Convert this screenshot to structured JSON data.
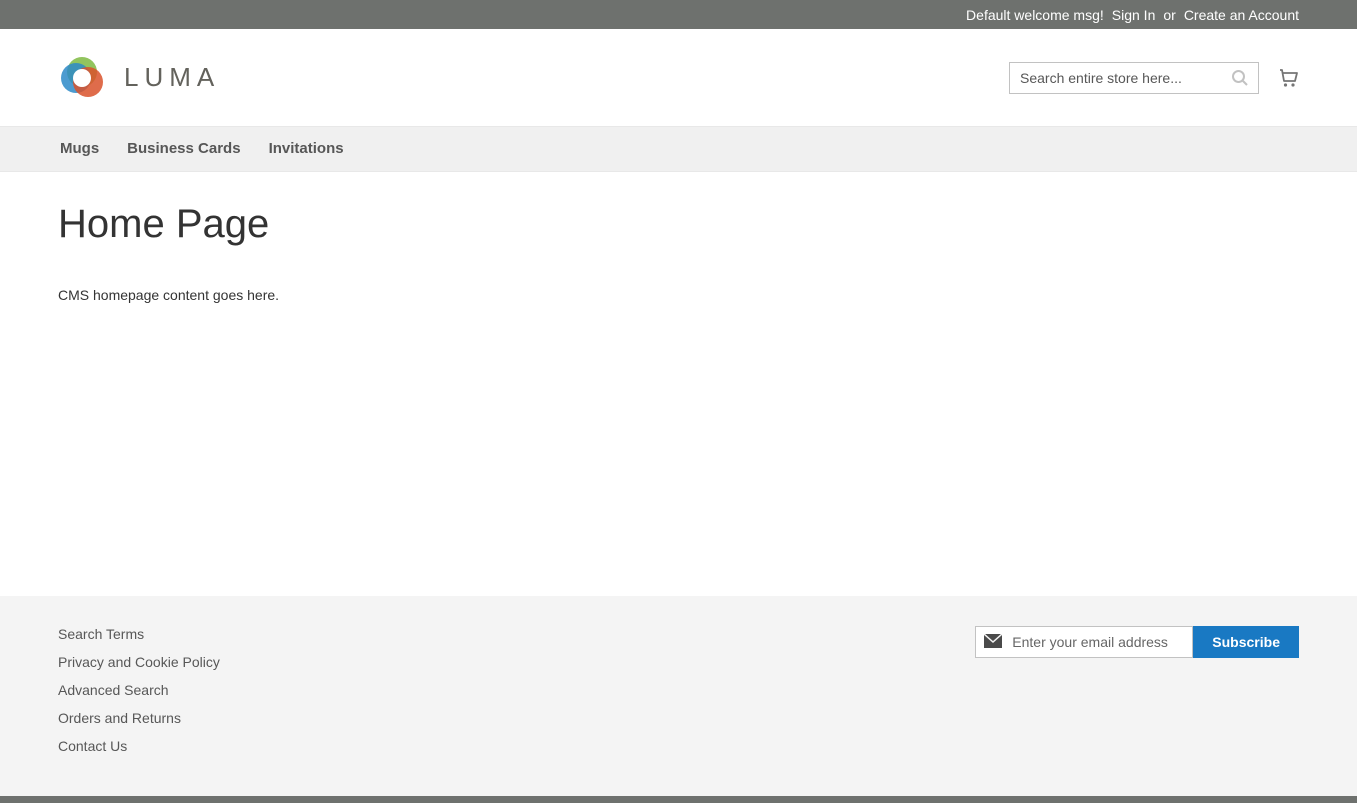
{
  "panel": {
    "welcome": "Default welcome msg!",
    "sign_in": "Sign In",
    "or": "or",
    "create_account": "Create an Account"
  },
  "logo": {
    "text": "LUMA"
  },
  "search": {
    "placeholder": "Search entire store here..."
  },
  "nav": {
    "items": [
      {
        "label": "Mugs"
      },
      {
        "label": "Business Cards"
      },
      {
        "label": "Invitations"
      }
    ]
  },
  "page": {
    "title": "Home Page",
    "content": "CMS homepage content goes here."
  },
  "footer": {
    "links": [
      {
        "label": "Search Terms"
      },
      {
        "label": "Privacy and Cookie Policy"
      },
      {
        "label": "Advanced Search"
      },
      {
        "label": "Orders and Returns"
      },
      {
        "label": "Contact Us"
      }
    ],
    "newsletter_placeholder": "Enter your email address",
    "subscribe_label": "Subscribe"
  }
}
